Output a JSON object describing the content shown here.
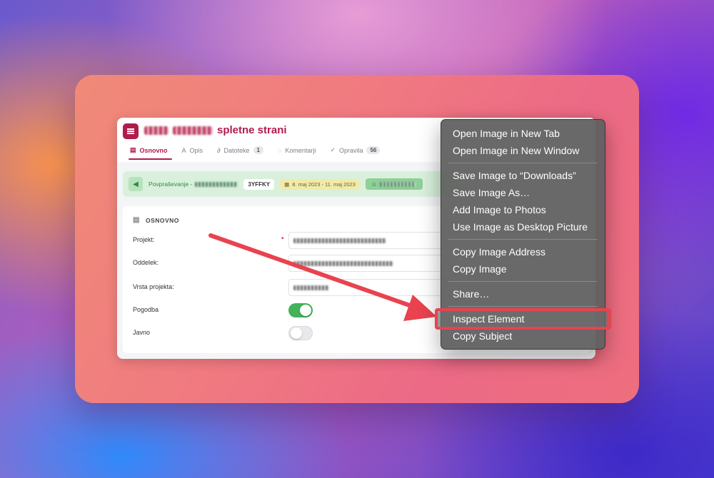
{
  "app": {
    "title": "spletne strani",
    "tabs": [
      {
        "label": "Osnovno",
        "icon": "document-icon",
        "active": true
      },
      {
        "label": "Opis",
        "icon": "text-icon"
      },
      {
        "label": "Datoteke",
        "icon": "paperclip-icon",
        "badge": "1"
      },
      {
        "label": "Komentarji",
        "icon": "chat-icon"
      },
      {
        "label": "Opravila",
        "icon": "check-icon",
        "badge": "56"
      }
    ],
    "info_bar": {
      "request_label": "Povpraševanje -",
      "code": "3YFFKY",
      "date_range": "8. maj 2023 - 11. maj 2023"
    },
    "form": {
      "section_title": "OSNOVNO",
      "fields": {
        "projekt": "Projekt:",
        "oddelek": "Oddelek:",
        "vrsta": "Vrsta projekta:",
        "pogodba": "Pogodba",
        "javno": "Javno"
      },
      "pogodba_on": true,
      "javno_on": false
    }
  },
  "context_menu": {
    "groups": [
      [
        "Open Image in New Tab",
        "Open Image in New Window"
      ],
      [
        "Save Image to “Downloads”",
        "Save Image As…",
        "Add Image to Photos",
        "Use Image as Desktop Picture"
      ],
      [
        "Copy Image Address",
        "Copy Image"
      ],
      [
        "Share…"
      ],
      [
        "Inspect Element",
        "Copy Subject"
      ]
    ],
    "highlighted": "Inspect Element"
  },
  "colors": {
    "brand": "#b01c4a",
    "highlight_outline": "#e8434f",
    "arrow": "#e8434f",
    "toggle_on": "#43b25a"
  }
}
